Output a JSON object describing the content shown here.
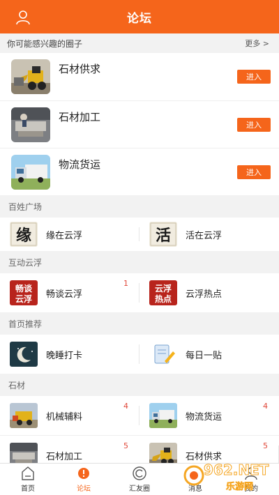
{
  "header": {
    "title": "论坛",
    "user_icon": "user-icon"
  },
  "recommend": {
    "title": "你可能感兴趣的圈子",
    "more": "更多 >",
    "items": [
      {
        "name": "石材供求",
        "join": "进入",
        "thumb": "excavator-photo"
      },
      {
        "name": "石材加工",
        "join": "进入",
        "thumb": "stone-processing-photo"
      },
      {
        "name": "物流货运",
        "join": "进入",
        "thumb": "truck-photo"
      }
    ]
  },
  "categories": [
    {
      "title": "百姓广场",
      "items": [
        {
          "label": "缘在云浮",
          "badge": "",
          "icon": "yuan-calligraphy-icon"
        },
        {
          "label": "活在云浮",
          "badge": "",
          "icon": "huo-calligraphy-icon"
        }
      ]
    },
    {
      "title": "互动云浮",
      "items": [
        {
          "label": "畅谈云浮",
          "badge": "1",
          "icon": "changtan-logo-icon",
          "icon_text": "畅谈云浮"
        },
        {
          "label": "云浮热点",
          "badge": "",
          "icon": "redian-logo-icon",
          "icon_text": "云浮热点"
        }
      ]
    },
    {
      "title": "首页推荐",
      "items": [
        {
          "label": "晚睡打卡",
          "badge": "",
          "icon": "moon-icon"
        },
        {
          "label": "每日一贴",
          "badge": "",
          "icon": "notepad-icon"
        }
      ]
    },
    {
      "title": "石材",
      "items": [
        {
          "label": "机械辅料",
          "badge": "4",
          "icon": "machinery-photo"
        },
        {
          "label": "物流货运",
          "badge": "4",
          "icon": "truck-photo"
        },
        {
          "label": "石材加工",
          "badge": "5",
          "icon": "stone-processing-photo"
        },
        {
          "label": "石材供求",
          "badge": "5",
          "icon": "excavator-photo"
        }
      ]
    }
  ],
  "tabbar": [
    {
      "label": "首页",
      "icon": "home-icon",
      "active": false
    },
    {
      "label": "论坛",
      "icon": "forum-icon",
      "active": true
    },
    {
      "label": "汇友圈",
      "icon": "circle-icon",
      "active": false
    },
    {
      "label": "消息",
      "icon": "message-icon",
      "active": false
    },
    {
      "label": "我的",
      "icon": "profile-icon",
      "active": false
    }
  ],
  "watermark": {
    "brand": "962.NET",
    "sub": "乐游网"
  },
  "colors": {
    "accent": "#f5651b",
    "badge": "#e0483a",
    "calligraphy_red": "#b8241c"
  }
}
